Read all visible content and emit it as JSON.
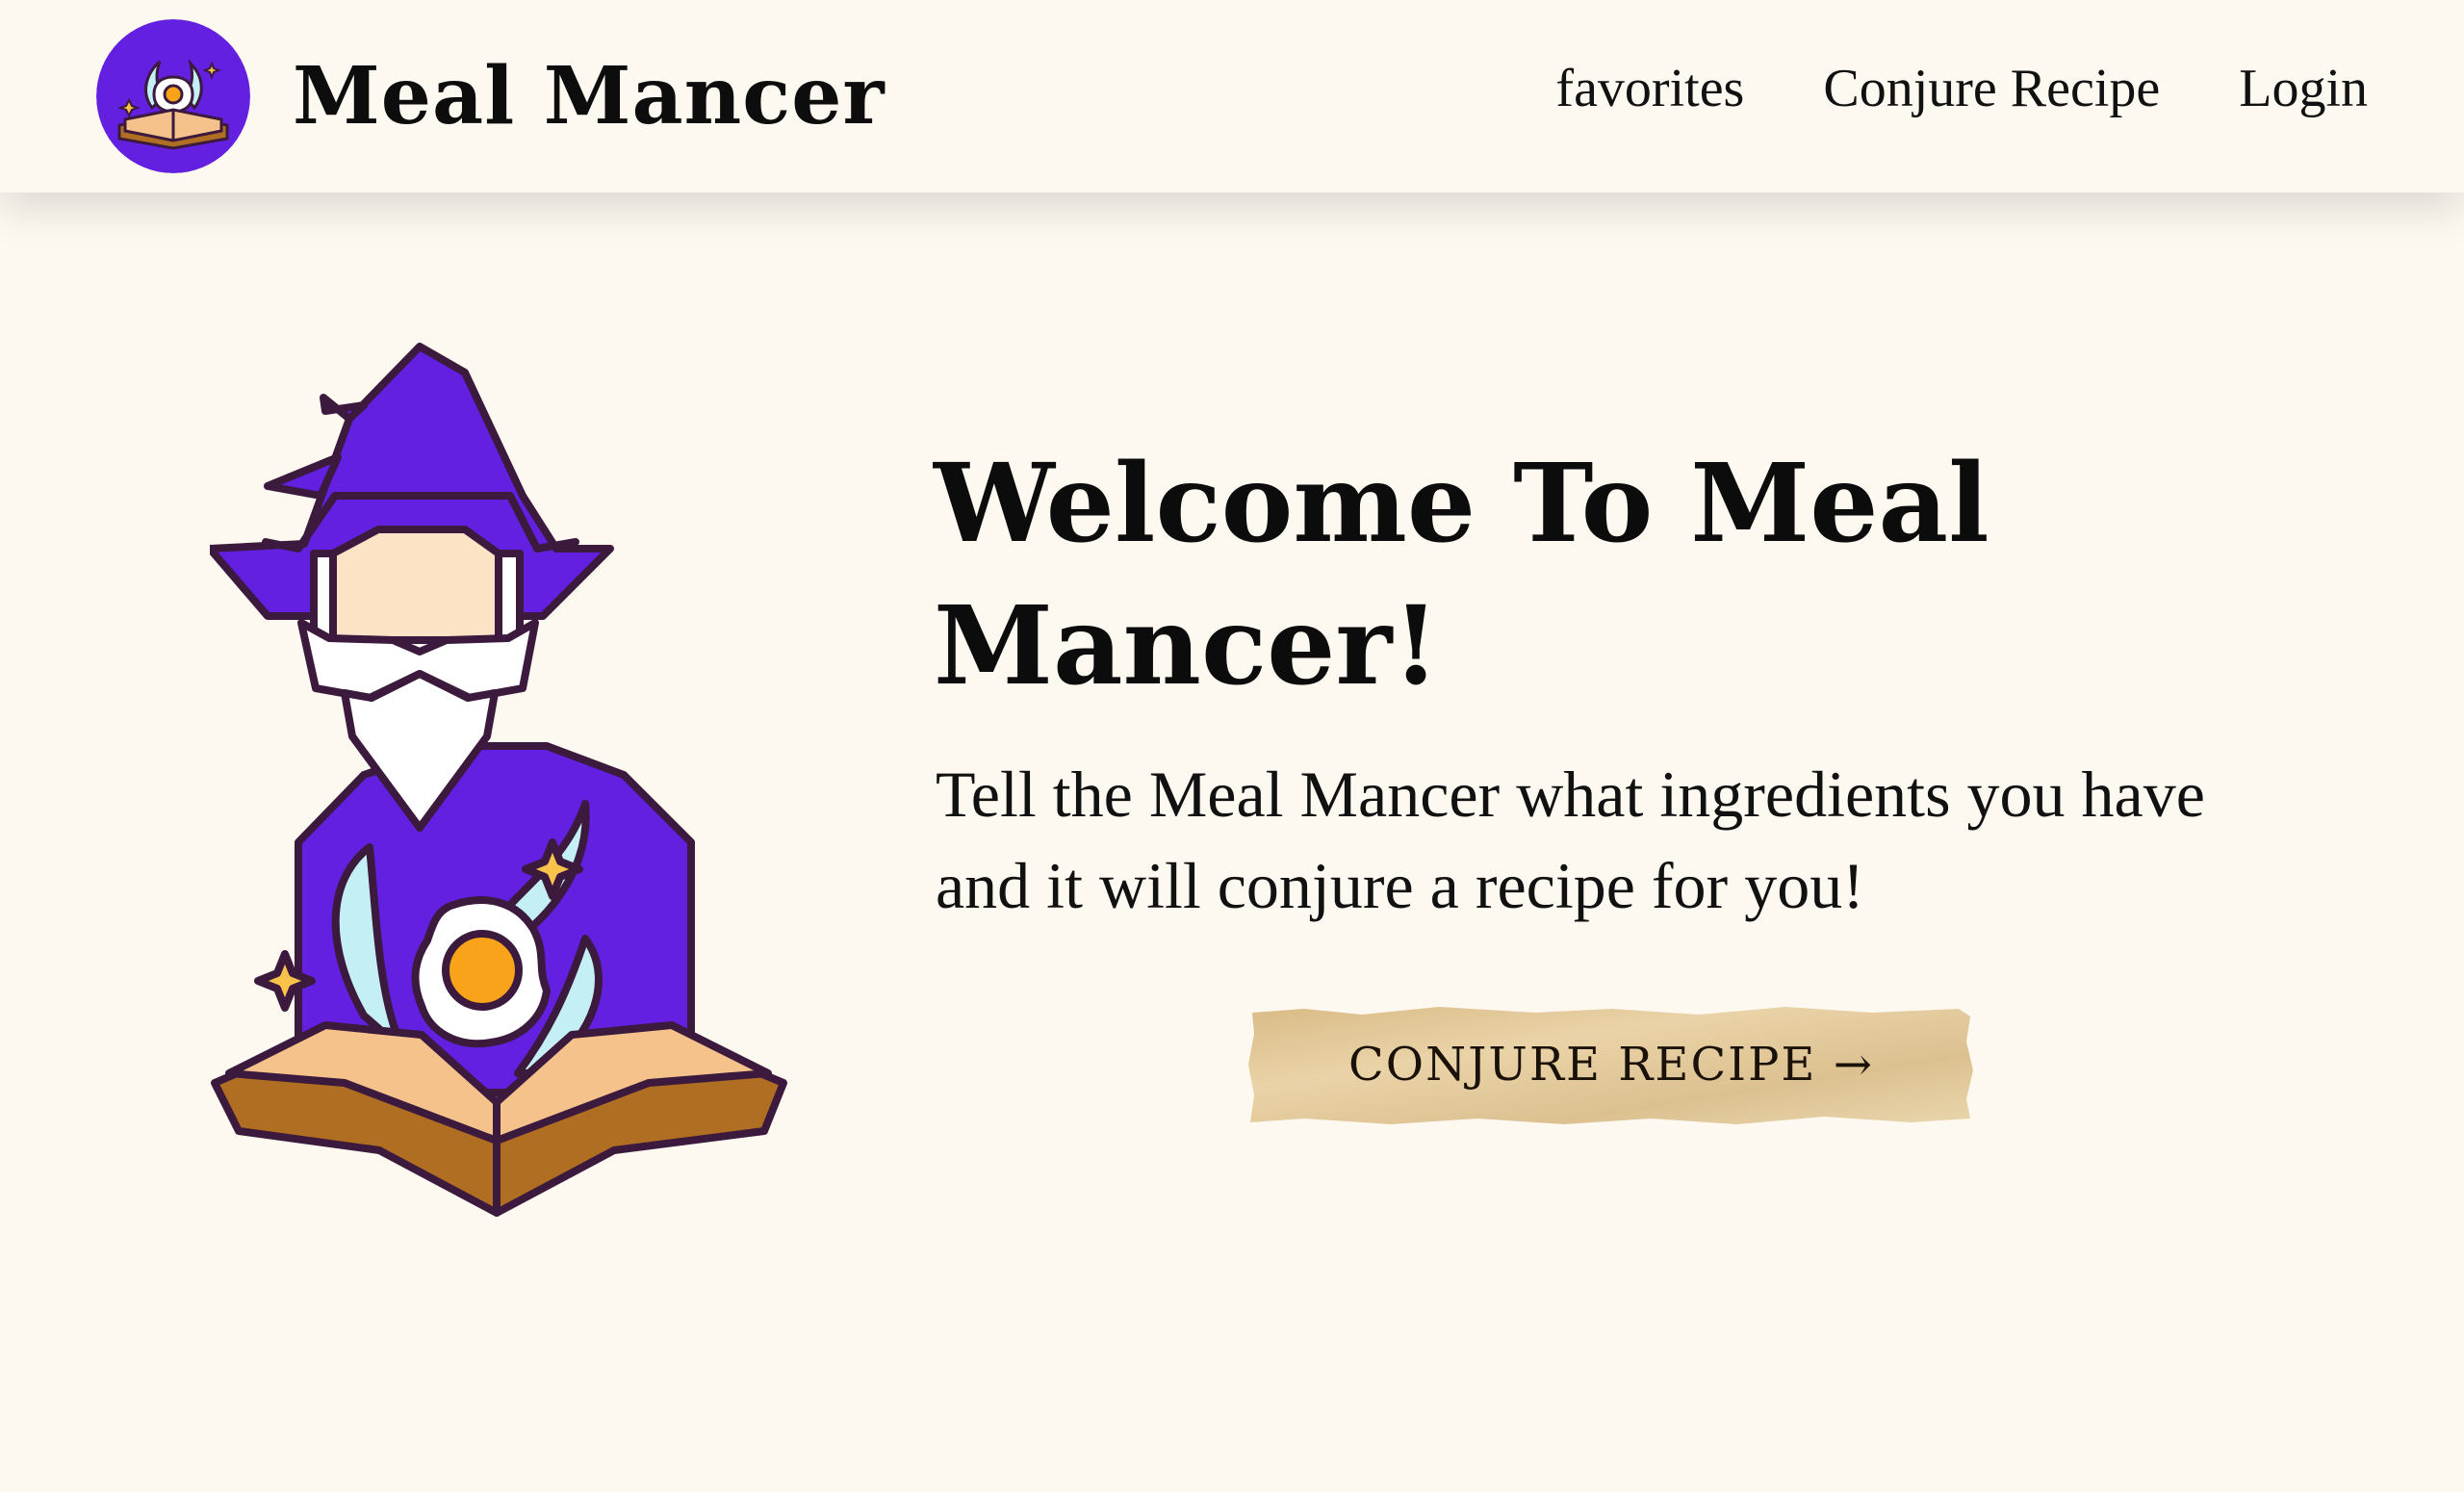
{
  "nav": {
    "brand": "Meal Mancer",
    "links": [
      {
        "label": "favorites"
      },
      {
        "label": "Conjure Recipe"
      },
      {
        "label": "Login"
      }
    ]
  },
  "hero": {
    "title": "Welcome To Meal Mancer!",
    "subtitle": "Tell the Meal Mancer what ingredients you have and it will conjure a recipe for you!",
    "cta_label": "CONJURE RECIPE →"
  },
  "colors": {
    "background": "#fdf8f0",
    "wizard_purple": "#6320e0",
    "outline": "#3b1a3e",
    "beard": "#ffffff",
    "face": "#fde3c6",
    "yolk": "#f9a31b",
    "spirit": "#c4f0f5",
    "book_page": "#f4c28a",
    "book_cover": "#b06e22",
    "sparkle": "#f9c24a",
    "parchment": "#e3c99a"
  },
  "icons": {
    "logo": "wizard-book-egg-logo",
    "hero": "wizard-illustration"
  }
}
